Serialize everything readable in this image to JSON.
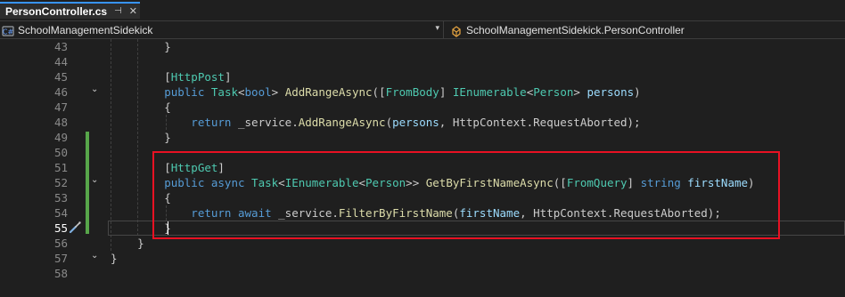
{
  "tab": {
    "title": "PersonController.cs",
    "pin_glyph": "⊣",
    "close_glyph": "✕"
  },
  "nav": {
    "project": "SchoolManagementSidekick",
    "class": "SchoolManagementSidekick.PersonController",
    "dropdown_glyph": "▾"
  },
  "editor": {
    "active_line": 55,
    "lines": [
      {
        "n": "43",
        "tokens": [
          [
            "pl",
            "        }"
          ]
        ]
      },
      {
        "n": "44",
        "tokens": []
      },
      {
        "n": "45",
        "tokens": [
          [
            "pl",
            "        ["
          ],
          [
            "at",
            "HttpPost"
          ],
          [
            "pl",
            "]"
          ]
        ]
      },
      {
        "n": "46",
        "tokens": [
          [
            "kw",
            "        public "
          ],
          [
            "ty",
            "Task"
          ],
          [
            "pl",
            "<"
          ],
          [
            "kw",
            "bool"
          ],
          [
            "pl",
            "> "
          ],
          [
            "mt",
            "AddRangeAsync"
          ],
          [
            "pl",
            "(["
          ],
          [
            "at",
            "FromBody"
          ],
          [
            "pl",
            "] "
          ],
          [
            "ty",
            "IEnumerable"
          ],
          [
            "pl",
            "<"
          ],
          [
            "ty",
            "Person"
          ],
          [
            "pl",
            "> "
          ],
          [
            "pm",
            "persons"
          ],
          [
            "pl",
            ")"
          ]
        ]
      },
      {
        "n": "47",
        "tokens": [
          [
            "pl",
            "        {"
          ]
        ]
      },
      {
        "n": "48",
        "tokens": [
          [
            "kw",
            "            return "
          ],
          [
            "pl",
            "_service."
          ],
          [
            "mt",
            "AddRangeAsync"
          ],
          [
            "pl",
            "("
          ],
          [
            "pm",
            "persons"
          ],
          [
            "pl",
            ", HttpContext.RequestAborted);"
          ]
        ]
      },
      {
        "n": "49",
        "tokens": [
          [
            "pl",
            "        }"
          ]
        ]
      },
      {
        "n": "50",
        "tokens": []
      },
      {
        "n": "51",
        "tokens": [
          [
            "pl",
            "        ["
          ],
          [
            "at",
            "HttpGet"
          ],
          [
            "pl",
            "]"
          ]
        ]
      },
      {
        "n": "52",
        "tokens": [
          [
            "kw",
            "        public async "
          ],
          [
            "ty",
            "Task"
          ],
          [
            "pl",
            "<"
          ],
          [
            "ty",
            "IEnumerable"
          ],
          [
            "pl",
            "<"
          ],
          [
            "ty",
            "Person"
          ],
          [
            "pl",
            ">> "
          ],
          [
            "mt",
            "GetByFirstNameAsync"
          ],
          [
            "pl",
            "(["
          ],
          [
            "at",
            "FromQuery"
          ],
          [
            "pl",
            "] "
          ],
          [
            "kw",
            "string "
          ],
          [
            "pm",
            "firstName"
          ],
          [
            "pl",
            ")"
          ]
        ]
      },
      {
        "n": "53",
        "tokens": [
          [
            "pl",
            "        {"
          ]
        ]
      },
      {
        "n": "54",
        "tokens": [
          [
            "kw",
            "            return await "
          ],
          [
            "pl",
            "_service."
          ],
          [
            "mt",
            "FilterByFirstName"
          ],
          [
            "pl",
            "("
          ],
          [
            "pm",
            "firstName"
          ],
          [
            "pl",
            ", HttpContext.RequestAborted);"
          ]
        ]
      },
      {
        "n": "55",
        "tokens": [
          [
            "pl",
            "        }"
          ]
        ]
      },
      {
        "n": "56",
        "tokens": [
          [
            "pl",
            "    }"
          ]
        ]
      },
      {
        "n": "57",
        "tokens": [
          [
            "pl",
            "}"
          ]
        ]
      },
      {
        "n": "58",
        "tokens": []
      }
    ],
    "fold_glyph": "⌄",
    "fold_lines": [
      "46",
      "52",
      "57"
    ],
    "changed_lines": [
      "49",
      "50",
      "51",
      "52",
      "53",
      "54",
      "55"
    ],
    "quick_action_icon": "screwdriver-icon"
  },
  "colors": {
    "highlight_box": "#e81123",
    "change_bar": "#57a64a",
    "keyword": "#569cd6",
    "type": "#4ec9b0",
    "method": "#dcdcaa",
    "parameter": "#9cdcfe"
  }
}
